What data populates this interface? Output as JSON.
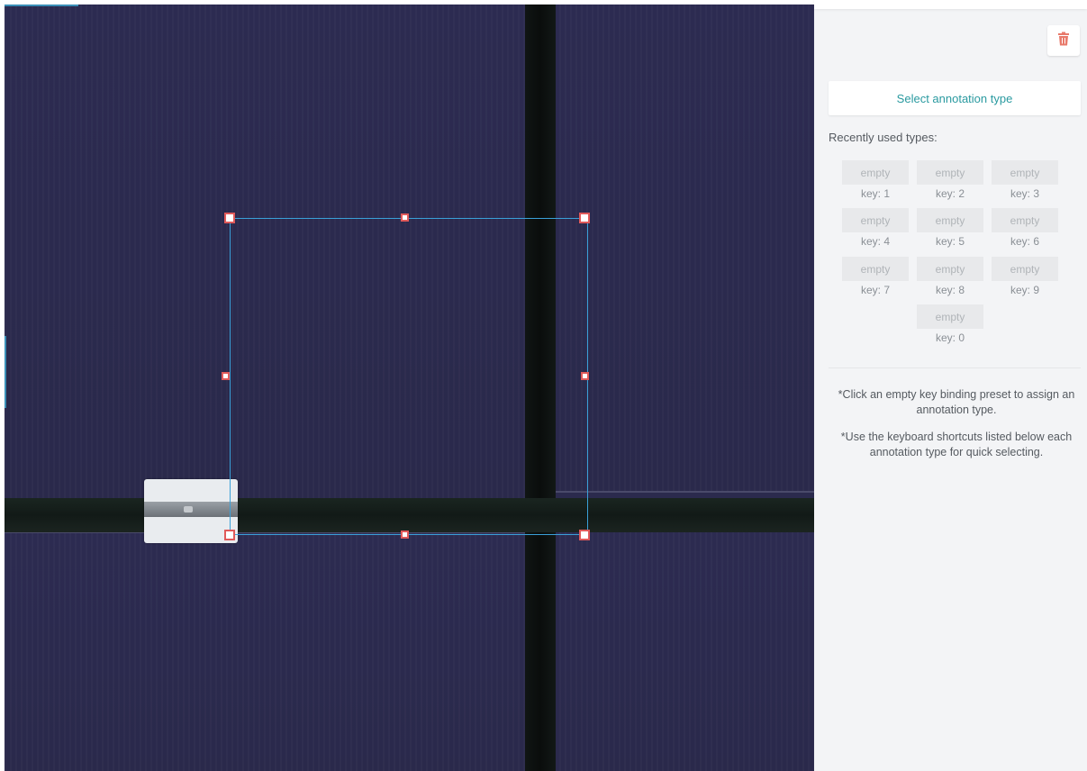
{
  "canvas": {
    "colors": {
      "panel": "#2b2a4d",
      "gap": "#0d1210",
      "bbox": "#3aa0d8",
      "handle": "#e05a5a"
    }
  },
  "sidebar": {
    "delete_icon": "trash-icon",
    "select_annotation_label": "Select annotation type",
    "recent_title": "Recently used types:",
    "presets": [
      {
        "label": "empty",
        "key": "key: 1"
      },
      {
        "label": "empty",
        "key": "key: 2"
      },
      {
        "label": "empty",
        "key": "key: 3"
      },
      {
        "label": "empty",
        "key": "key: 4"
      },
      {
        "label": "empty",
        "key": "key: 5"
      },
      {
        "label": "empty",
        "key": "key: 6"
      },
      {
        "label": "empty",
        "key": "key: 7"
      },
      {
        "label": "empty",
        "key": "key: 8"
      },
      {
        "label": "empty",
        "key": "key: 9"
      },
      {
        "label": "empty",
        "key": "key: 0"
      }
    ],
    "hint_1": "*Click an empty key binding preset to assign an annotation type.",
    "hint_2": "*Use the keyboard shortcuts listed below each annotation type for quick selecting.",
    "accent_color": "#2a9aa0",
    "delete_color": "#e8796a"
  }
}
